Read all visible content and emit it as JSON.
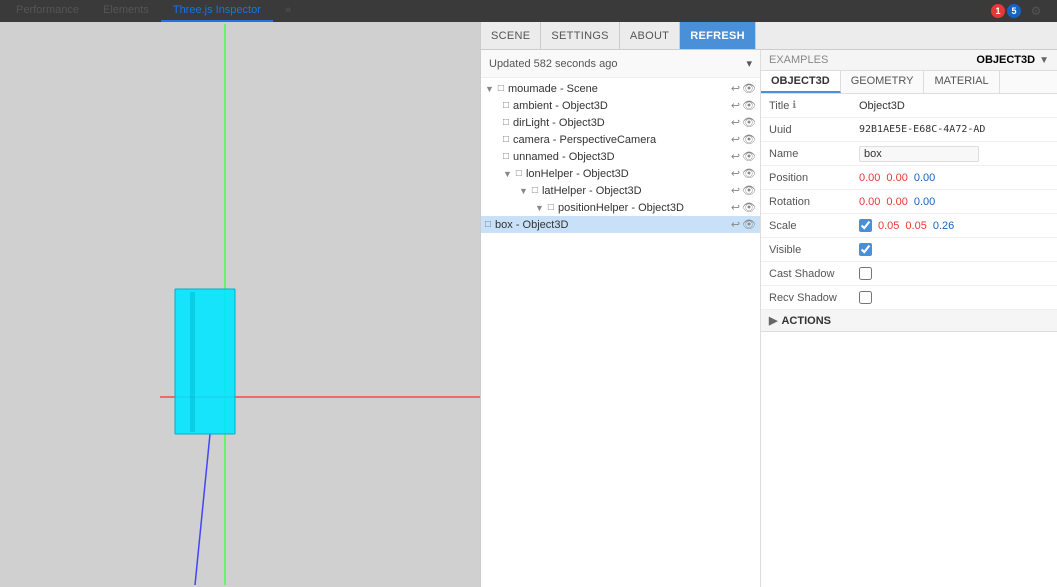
{
  "browser": {
    "tabs": [
      {
        "label": "Performance",
        "active": false
      },
      {
        "label": "Elements",
        "active": false
      },
      {
        "label": "Three.js Inspector",
        "active": true
      }
    ],
    "more_tabs_icon": "»",
    "ext_error_count": "1",
    "ext_count": "5",
    "settings_icon": "⚙"
  },
  "inspector_nav": {
    "tabs": [
      {
        "label": "SCENE",
        "active": false
      },
      {
        "label": "SETTINGS",
        "active": false
      },
      {
        "label": "ABOUT",
        "active": false
      },
      {
        "label": "Refresh",
        "active": true,
        "style": "refresh"
      }
    ]
  },
  "scene_tree": {
    "updated_text": "Updated 582 seconds ago",
    "items": [
      {
        "id": 1,
        "depth": 0,
        "name": "moumade - Scene",
        "has_arrow": true,
        "arrow": "▼",
        "has_box": true,
        "box": "□",
        "actions": [
          "↩",
          "👁"
        ]
      },
      {
        "id": 2,
        "depth": 1,
        "name": "ambient - Object3D",
        "has_box": true,
        "box": "□",
        "actions": [
          "↩",
          "👁"
        ]
      },
      {
        "id": 3,
        "depth": 1,
        "name": "dirLight - Object3D",
        "has_box": true,
        "box": "□",
        "actions": [
          "↩",
          "👁"
        ]
      },
      {
        "id": 4,
        "depth": 1,
        "name": "camera - PerspectiveCamera",
        "has_box": true,
        "box": "□",
        "actions": [
          "↩",
          "👁"
        ]
      },
      {
        "id": 5,
        "depth": 1,
        "name": "unnamed - Object3D",
        "has_box": true,
        "box": "□",
        "actions": [
          "↩",
          "👁"
        ]
      },
      {
        "id": 6,
        "depth": 1,
        "name": "lonHelper - Object3D",
        "has_arrow": true,
        "arrow": "▼",
        "has_box": true,
        "box": "□",
        "actions": [
          "↩",
          "👁"
        ]
      },
      {
        "id": 7,
        "depth": 2,
        "name": "latHelper - Object3D",
        "has_arrow": true,
        "arrow": "▼",
        "has_box": true,
        "box": "□",
        "actions": [
          "↩",
          "👁"
        ]
      },
      {
        "id": 8,
        "depth": 3,
        "name": "positionHelper - Object3D",
        "has_arrow": true,
        "arrow": "▼",
        "has_box": true,
        "box": "□",
        "actions": [
          "↩",
          "👁"
        ]
      },
      {
        "id": 9,
        "depth": 0,
        "name": "box - Object3D",
        "has_box": true,
        "box": "□",
        "selected": true,
        "actions": [
          "↩",
          "👁"
        ]
      }
    ]
  },
  "object_props": {
    "examples_label": "EXAMPLES",
    "object_title": "OBJECT3D",
    "chevron": "▼",
    "props_tabs": [
      {
        "label": "OBJECT3D",
        "active": true
      },
      {
        "label": "GEOMETRY",
        "active": false
      },
      {
        "label": "MATERIAL",
        "active": false
      }
    ],
    "fields": [
      {
        "label": "Title",
        "info": true,
        "value": "Object3D",
        "type": "text"
      },
      {
        "label": "Uuid",
        "value": "92B1AE5E-E68C-4A72-AD",
        "type": "text"
      },
      {
        "label": "Name",
        "value": "box",
        "type": "text-input"
      },
      {
        "label": "Position",
        "type": "xyz",
        "x": "0.00",
        "y": "0.00",
        "z": "0.00",
        "x_color": "red",
        "y_color": "red",
        "z_color": "blue"
      },
      {
        "label": "Rotation",
        "type": "xyz",
        "x": "0.00",
        "y": "0.00",
        "z": "0.00",
        "x_color": "red",
        "y_color": "red",
        "z_color": "blue"
      },
      {
        "label": "Scale",
        "type": "xyz_checkbox",
        "checkbox": true,
        "x": "0.05",
        "y": "0.05",
        "z": "0.26",
        "x_color": "red",
        "y_color": "red",
        "z_color": "blue"
      },
      {
        "label": "Visible",
        "type": "checkbox",
        "checked": true
      },
      {
        "label": "Cast Shadow",
        "type": "checkbox",
        "checked": false
      },
      {
        "label": "Recv Shadow",
        "type": "checkbox",
        "checked": false
      }
    ],
    "actions_section": "ACTIONS"
  }
}
